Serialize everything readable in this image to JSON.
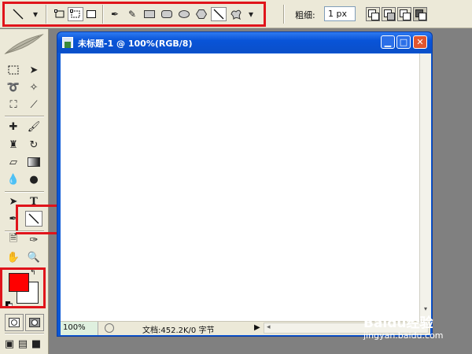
{
  "options_bar": {
    "weight_label": "粗细:",
    "weight_value": "1 px",
    "tools": [
      "line-icon",
      "dropdown-arrow-icon",
      "shape-layers-icon",
      "paths-icon",
      "fill-pixels-icon",
      "pen-icon",
      "freeform-pen-icon",
      "rectangle-icon",
      "rounded-rectangle-icon",
      "ellipse-icon",
      "polygon-icon",
      "line-icon",
      "custom-shape-icon"
    ]
  },
  "toolbox": {
    "colors": {
      "foreground": "#ff0000",
      "background": "#ffffff"
    }
  },
  "document": {
    "title": "未标题-1 @ 100%(RGB/8)",
    "zoom": "100%",
    "status": "文档:452.2K/0 字节"
  },
  "watermark": {
    "brand": "Baidu经验",
    "url": "jingyan.baidu.com"
  }
}
